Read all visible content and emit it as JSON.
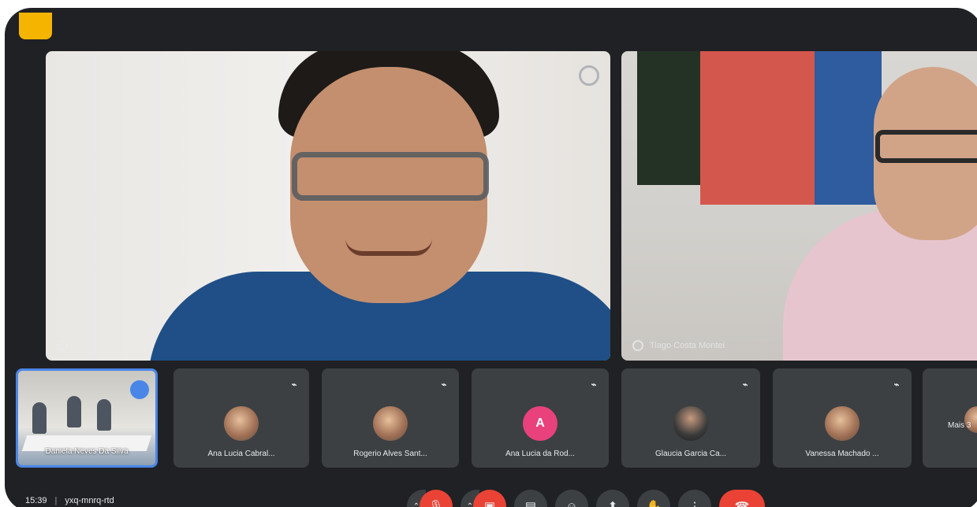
{
  "main_tiles": [
    {
      "name": "",
      "menu_icon": "more-options-icon"
    },
    {
      "name": "Tiago Costa Montei"
    }
  ],
  "filmstrip": [
    {
      "name": "Daniela Neves Da Silva",
      "type": "room",
      "active": true,
      "badge_icon": "chat-bubble-icon"
    },
    {
      "name": "Ana Lucia Cabral...",
      "type": "photo",
      "muted": true
    },
    {
      "name": "Rogerio Alves Sant...",
      "type": "photo",
      "muted": true
    },
    {
      "name": "Ana Lucia da Rod...",
      "type": "letter",
      "initial": "A",
      "muted": true
    },
    {
      "name": "Glaucia Garcia Ca...",
      "type": "photo-dark",
      "muted": true
    },
    {
      "name": "Vanessa Machado ...",
      "type": "photo",
      "muted": true
    },
    {
      "name": "Mais 3",
      "type": "more"
    }
  ],
  "bottom_bar": {
    "time": "15:39",
    "meeting_code": "yxq-mnrq-rtd",
    "controls": [
      {
        "name": "mic-off",
        "icon": "mic-off-icon",
        "glyph": "🎙",
        "red": true,
        "caret": true
      },
      {
        "name": "camera-off",
        "icon": "camera-off-icon",
        "glyph": "▣",
        "red": true,
        "caret": true
      },
      {
        "name": "captions",
        "icon": "captions-icon",
        "glyph": "▤"
      },
      {
        "name": "reactions",
        "icon": "emoji-icon",
        "glyph": "☺"
      },
      {
        "name": "present",
        "icon": "present-screen-icon",
        "glyph": "⬆"
      },
      {
        "name": "raise-hand",
        "icon": "hand-icon",
        "glyph": "✋"
      },
      {
        "name": "more-options",
        "icon": "more-vert-icon",
        "glyph": "⋮"
      },
      {
        "name": "leave-call",
        "icon": "call-end-icon",
        "glyph": "☎",
        "end": true
      }
    ]
  },
  "colors": {
    "background": "#202124",
    "tile": "#3c4043",
    "accent": "#4a86e8",
    "danger": "#ea4335",
    "text": "#e8eaed"
  }
}
